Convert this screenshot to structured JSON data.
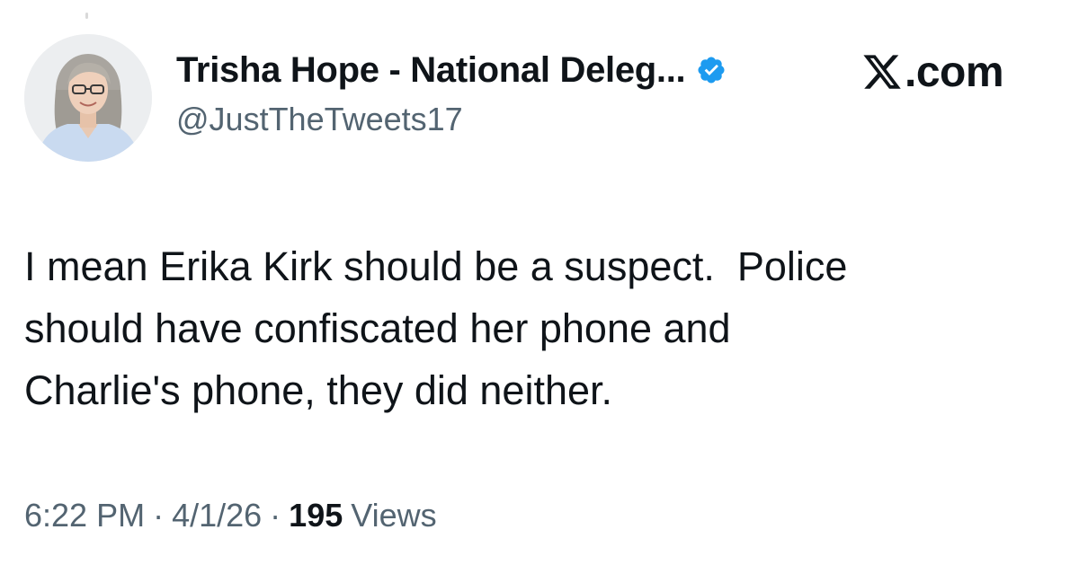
{
  "author": {
    "display_name": "Trisha Hope - National Deleg...",
    "handle": "@JustTheTweets17",
    "verified": true,
    "avatar_icon": "profile-photo"
  },
  "source": {
    "logo_icon": "x-logo",
    "domain": ".com"
  },
  "tweet": {
    "lines": [
      "I mean Erika Kirk should be a suspect.  Police",
      "should have confiscated her phone and",
      "Charlie's phone, they did neither."
    ]
  },
  "meta": {
    "time": "6:22 PM",
    "separator": "·",
    "date": "4/1/26",
    "views_count": "195",
    "views_label": "Views"
  },
  "colors": {
    "verified_badge": "#1d9bf0",
    "text_primary": "#0f1419",
    "text_secondary": "#536471",
    "background": "#ffffff"
  }
}
